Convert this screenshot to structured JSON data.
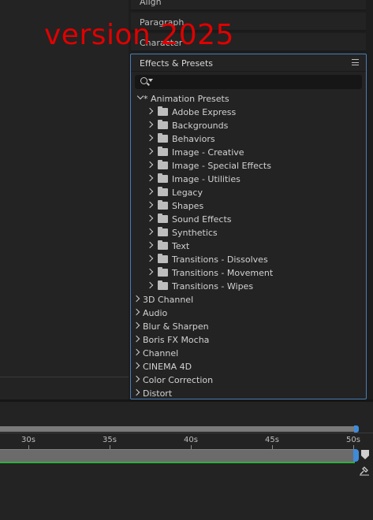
{
  "collapsed_panels": {
    "align": "Align",
    "paragraph": "Paragraph",
    "character": "Character"
  },
  "watermark": "version 2025",
  "effects_panel": {
    "title": "Effects & Presets",
    "search_value": "",
    "accent_color": "#4a7fb5",
    "animation_presets": {
      "label": "* Animation Presets",
      "children": [
        "Adobe Express",
        "Backgrounds",
        "Behaviors",
        "Image - Creative",
        "Image - Special Effects",
        "Image - Utilities",
        "Legacy",
        "Shapes",
        "Sound Effects",
        "Synthetics",
        "Text",
        "Transitions - Dissolves",
        "Transitions - Movement",
        "Transitions - Wipes"
      ]
    },
    "categories": [
      "3D Channel",
      "Audio",
      "Blur & Sharpen",
      "Boris FX Mocha",
      "Channel",
      "CINEMA 4D",
      "Color Correction",
      "Distort"
    ]
  },
  "timeline": {
    "ticks": [
      "30s",
      "35s",
      "40s",
      "45s",
      "50s"
    ],
    "work_area_color": "#3f8bd8",
    "layer_bar_color": "#2fae3f"
  }
}
